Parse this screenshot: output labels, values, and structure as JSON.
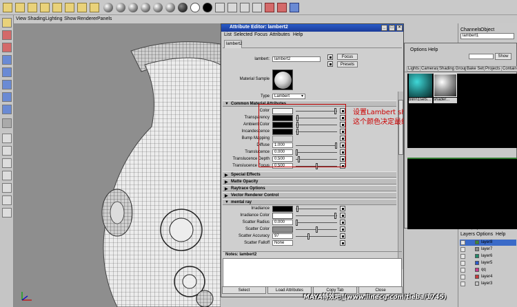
{
  "viewport": {
    "menu": [
      "View",
      "Shading",
      "Lighting",
      "Show",
      "Renderer",
      "Panels"
    ]
  },
  "attribute_editor": {
    "title": "Attribute Editor: lambert2",
    "menu": [
      "List",
      "Selected",
      "Focus",
      "Attributes",
      "Help"
    ],
    "tab": "lambert2",
    "node_type_label": "lambert:",
    "node_name": "lambert2",
    "focus_label": "Focus",
    "presets_label": "Presets",
    "material_sample_label": "Material Sample",
    "type_label": "Type",
    "type_value": "Lambert",
    "common_section": "Common Material Attributes",
    "attributes": [
      {
        "label": "Color",
        "swatch": "#f2f2f2",
        "slider": 0.98
      },
      {
        "label": "Transparency",
        "swatch": "#000000",
        "slider": 0.02
      },
      {
        "label": "Ambient Color",
        "swatch": "#000000",
        "slider": 0.02
      },
      {
        "label": "Incandescence",
        "swatch": "#000000",
        "slider": 0.02
      },
      {
        "label": "Bump Mapping",
        "swatch": "",
        "slider": null
      },
      {
        "label": "Diffuse",
        "value": "1.000",
        "slider": 1.0
      },
      {
        "label": "Translucence",
        "value": "0.000",
        "slider": 0.0
      },
      {
        "label": "Translucence Depth",
        "value": "0.500",
        "slider": 0.05
      },
      {
        "label": "Translucence Focus",
        "value": "0.500",
        "slider": 0.5
      }
    ],
    "collapsed_sections": [
      "Special Effects",
      "Matte Opacity",
      "Raytrace Options",
      "Vector Renderer Control"
    ],
    "mental_ray_section": "mental ray",
    "mental_ray": [
      {
        "label": "Irradiance",
        "swatch": "#000000",
        "slider": 0.02
      },
      {
        "label": "Irradiance Color",
        "swatch": "#ffffff",
        "slider": 0.98
      },
      {
        "label": "Scatter Radius",
        "value": "0.000",
        "slider": 0.0
      },
      {
        "label": "Scatter Color",
        "swatch": "#8c8c8c",
        "slider": 0.5
      },
      {
        "label": "Scatter Accuracy",
        "value": "97",
        "slider": 0.3
      },
      {
        "label": "Scatter Falloff",
        "value": "None",
        "slider": null
      }
    ],
    "notes_label": "Notes:  lambert2",
    "buttons": [
      "Select",
      "Load Attributes",
      "Copy Tab",
      "Close"
    ]
  },
  "annotation": {
    "line1": "设置Lambert shader 的Color为白色。",
    "line2": "这个颜色决定最终渲染时模型表面的颜色"
  },
  "channel_box": {
    "tabs": [
      "Channels",
      "Object"
    ],
    "field": "lambert1"
  },
  "hypershade": {
    "menu": [
      "Options",
      "Help"
    ],
    "show_label": "Show",
    "tabs": [
      "Lights",
      "Cameras",
      "Shading Groups",
      "Bake Sets",
      "Projects",
      "Containers"
    ],
    "materials": [
      "blinn1sets...",
      "shader..."
    ]
  },
  "layer_editor": {
    "menu": [
      "Layers",
      "Options",
      "Help"
    ],
    "display_label": "Display",
    "render_label": "Render",
    "layers": [
      {
        "name": "layer8",
        "color": "#3b8a3b"
      },
      {
        "name": "layer7",
        "color": "#8a8a8a"
      },
      {
        "name": "layer6",
        "color": "#1f8a6a"
      },
      {
        "name": "layer5",
        "color": "#2a5ac8"
      },
      {
        "name": "qq",
        "color": "#c83a8a"
      },
      {
        "name": "layer4",
        "color": "#c83a3a"
      },
      {
        "name": "layer3",
        "color": "#c8c8c8"
      }
    ]
  },
  "watermark": "MAYA特效吧_(www.linecg.com/tieba/1745)",
  "colors": {
    "title_bar": "#2a5cc8",
    "annotation": "#cc0000",
    "viewport_bg": "#8e8e8e"
  }
}
